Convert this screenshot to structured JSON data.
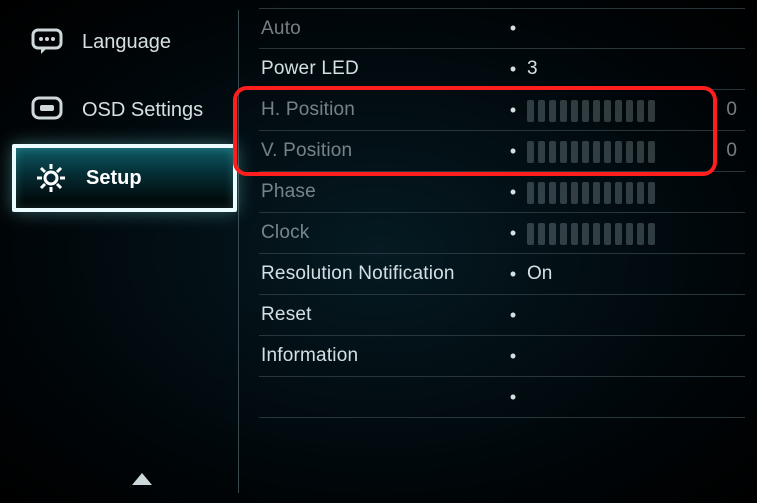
{
  "sidebar": {
    "items": [
      {
        "label": "Language"
      },
      {
        "label": "OSD Settings"
      },
      {
        "label": "Setup"
      }
    ]
  },
  "main": {
    "rows": [
      {
        "label": "Auto",
        "bullet": "•",
        "value": ""
      },
      {
        "label": "Power LED",
        "bullet": "•",
        "value": "3"
      },
      {
        "label": "H. Position",
        "bullet": "•",
        "value": "__bar__",
        "num": "0"
      },
      {
        "label": "V. Position",
        "bullet": "•",
        "value": "__bar__",
        "num": "0"
      },
      {
        "label": "Phase",
        "bullet": "•",
        "value": "__bar__"
      },
      {
        "label": "Clock",
        "bullet": "•",
        "value": "__bar__"
      },
      {
        "label": "Resolution Notification",
        "bullet": "•",
        "value": "On"
      },
      {
        "label": "Reset",
        "bullet": "•",
        "value": ""
      },
      {
        "label": "Information",
        "bullet": "•",
        "value": ""
      },
      {
        "label": "",
        "bullet": "•",
        "value": ""
      }
    ]
  },
  "highlighted_rows": [
    2,
    3
  ],
  "dim_rows": [
    0,
    2,
    3,
    4,
    5
  ]
}
